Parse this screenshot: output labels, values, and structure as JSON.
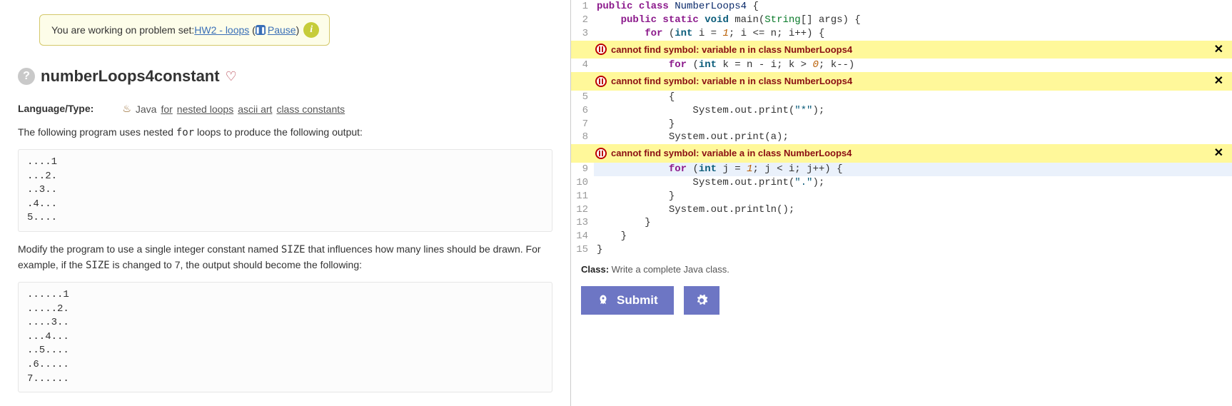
{
  "notice": {
    "prefix": "You are working on problem set: ",
    "link": "HW2 - loops",
    "pause_label": "Pause"
  },
  "problem": {
    "title": "numberLoops4constant",
    "lang_label": "Language/Type:",
    "lang_value": "Java",
    "tags": [
      "for",
      "nested loops",
      "ascii art",
      "class constants"
    ],
    "desc1_a": "The following program uses nested ",
    "desc1_code": "for",
    "desc1_b": " loops to produce the following output:",
    "output1": "....1\n...2.\n..3..\n.4...\n5....",
    "desc2_a": "Modify the program to use a single integer constant named ",
    "desc2_code": "SIZE",
    "desc2_b": " that influences how many lines should be drawn. For example, if the ",
    "desc2_code2": "SIZE",
    "desc2_c": " is changed to 7, the output should become the following:",
    "output2": "......1\n.....2.\n....3..\n...4...\n..5....\n.6.....\n7......"
  },
  "code": {
    "lines": [
      {
        "n": 1,
        "tokens": [
          {
            "t": "public ",
            "c": "kw"
          },
          {
            "t": "class ",
            "c": "kw"
          },
          {
            "t": "NumberLoops4",
            "c": "cls"
          },
          {
            "t": " {",
            "c": ""
          }
        ]
      },
      {
        "n": 2,
        "tokens": [
          {
            "t": "    ",
            "c": ""
          },
          {
            "t": "public static ",
            "c": "kw"
          },
          {
            "t": "void ",
            "c": "kw2"
          },
          {
            "t": "main",
            "c": ""
          },
          {
            "t": "(",
            "c": ""
          },
          {
            "t": "String",
            "c": "type"
          },
          {
            "t": "[] args) {",
            "c": ""
          }
        ]
      },
      {
        "n": 3,
        "tokens": [
          {
            "t": "        ",
            "c": ""
          },
          {
            "t": "for ",
            "c": "kw"
          },
          {
            "t": "(",
            "c": ""
          },
          {
            "t": "int ",
            "c": "kw2"
          },
          {
            "t": "i = ",
            "c": ""
          },
          {
            "t": "1",
            "c": "num"
          },
          {
            "t": "; i <= n; i++) {",
            "c": ""
          }
        ]
      },
      {
        "error": "cannot find symbol: variable n in class NumberLoops4"
      },
      {
        "n": 4,
        "tokens": [
          {
            "t": "            ",
            "c": ""
          },
          {
            "t": "for ",
            "c": "kw"
          },
          {
            "t": "(",
            "c": ""
          },
          {
            "t": "int ",
            "c": "kw2"
          },
          {
            "t": "k = n - i; k > ",
            "c": ""
          },
          {
            "t": "0",
            "c": "num"
          },
          {
            "t": "; k--)",
            "c": ""
          }
        ]
      },
      {
        "error": "cannot find symbol: variable n in class NumberLoops4"
      },
      {
        "n": 5,
        "tokens": [
          {
            "t": "            {",
            "c": ""
          }
        ]
      },
      {
        "n": 6,
        "tokens": [
          {
            "t": "                System.out.print(",
            "c": ""
          },
          {
            "t": "\"*\"",
            "c": "str"
          },
          {
            "t": ");",
            "c": ""
          }
        ]
      },
      {
        "n": 7,
        "tokens": [
          {
            "t": "            }",
            "c": ""
          }
        ]
      },
      {
        "n": 8,
        "tokens": [
          {
            "t": "            System.out.print(a);",
            "c": ""
          }
        ]
      },
      {
        "error": "cannot find symbol: variable a in class NumberLoops4"
      },
      {
        "n": 9,
        "hl": true,
        "tokens": [
          {
            "t": "            ",
            "c": ""
          },
          {
            "t": "for ",
            "c": "kw"
          },
          {
            "t": "(",
            "c": ""
          },
          {
            "t": "int ",
            "c": "kw2"
          },
          {
            "t": "j = ",
            "c": ""
          },
          {
            "t": "1",
            "c": "num"
          },
          {
            "t": "; j < i; j++) {",
            "c": ""
          }
        ]
      },
      {
        "n": 10,
        "tokens": [
          {
            "t": "                System.out.print(",
            "c": ""
          },
          {
            "t": "\".\"",
            "c": "str"
          },
          {
            "t": ");",
            "c": ""
          }
        ]
      },
      {
        "n": 11,
        "tokens": [
          {
            "t": "            }",
            "c": ""
          }
        ]
      },
      {
        "n": 12,
        "tokens": [
          {
            "t": "            System.out.println();",
            "c": ""
          }
        ]
      },
      {
        "n": 13,
        "tokens": [
          {
            "t": "        }",
            "c": ""
          }
        ]
      },
      {
        "n": 14,
        "tokens": [
          {
            "t": "    }",
            "c": ""
          }
        ]
      },
      {
        "n": 15,
        "tokens": [
          {
            "t": "}",
            "c": ""
          }
        ]
      }
    ]
  },
  "hint": {
    "label": "Class:",
    "text": " Write a complete Java class."
  },
  "buttons": {
    "submit": "Submit"
  }
}
